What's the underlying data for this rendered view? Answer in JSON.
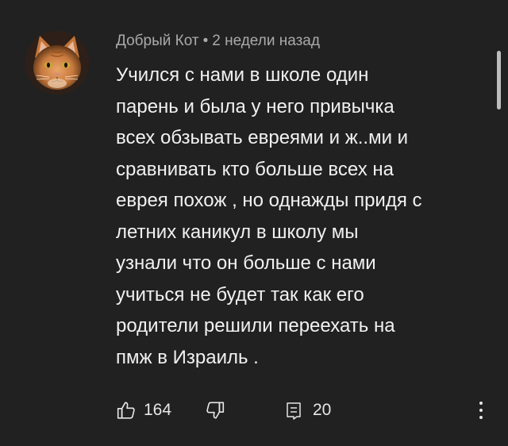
{
  "comment": {
    "author": "Добрый Кот",
    "separator": "•",
    "time": "2 недели назад",
    "text_lines": [
      "Учился с нами в школе один",
      "парень и была у него привычка",
      "всех обзывать евреями и ж..ми и",
      "сравнивать кто больше всех на",
      "еврея похож , но однажды придя с",
      "летних каникул в школу мы",
      "узнали что он больше с нами",
      "учиться не будет так как его",
      "родители решили переехать на",
      "пмж в Израиль ."
    ],
    "avatar_icon": "cat-avatar"
  },
  "actions": {
    "like_icon": "thumbs-up-icon",
    "like_count": "164",
    "dislike_icon": "thumbs-down-icon",
    "reply_icon": "comment-icon",
    "reply_count": "20",
    "more_icon": "more-vertical-icon"
  },
  "colors": {
    "background": "#212121",
    "text": "#f1f1f1",
    "meta": "#aaaaaa"
  }
}
